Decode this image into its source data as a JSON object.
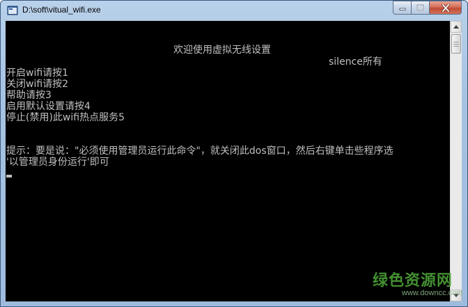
{
  "window": {
    "title": "D:\\soft\\vitual_wifi.exe"
  },
  "console": {
    "lines": [
      "欢迎使用虚拟无线设置",
      "silence所有",
      "开启wifi请按1",
      "关闭wifi请按2",
      "帮助请按3",
      "启用默认设置请按4",
      "停止(禁用)此wifi热点服务5",
      "提示：要是说：\"必须使用管理员运行此命令\"，就关闭此dos窗口，然后右键单击些程序选",
      "'以管理员身份运行'即可"
    ]
  },
  "watermark": {
    "main": "绿色资源网",
    "sub": "www.downcc.com"
  },
  "colors": {
    "console_bg": "#000000",
    "console_text": "#c0c0c0",
    "title_bar": "#b9d1ea",
    "close_button": "#c04a33",
    "watermark": "#4fa83a"
  },
  "icons": {
    "app": "console-app-icon",
    "minimize": "minimize-icon",
    "maximize": "maximize-icon",
    "close": "close-icon",
    "scroll_up": "arrow-up-icon",
    "scroll_down": "arrow-down-icon"
  }
}
